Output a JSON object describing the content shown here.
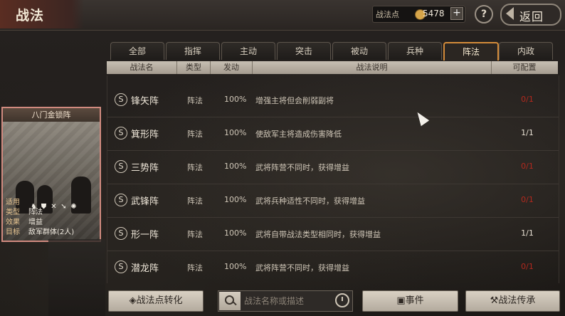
{
  "header": {
    "title": "战法",
    "points_label": "战法点",
    "points_value": "5478",
    "plus": "+",
    "help": "?",
    "back_label": "返回"
  },
  "tabs": [
    {
      "label": "全部"
    },
    {
      "label": "指挥"
    },
    {
      "label": "主动"
    },
    {
      "label": "突击"
    },
    {
      "label": "被动"
    },
    {
      "label": "兵种"
    },
    {
      "label": "阵法",
      "active": true
    },
    {
      "label": "内政"
    }
  ],
  "table": {
    "headers": [
      "战法名",
      "类型",
      "发动",
      "战法说明",
      "可配置"
    ],
    "rows": [
      {
        "grade": "S",
        "name": "锋矢阵",
        "type": "阵法",
        "rate": "100%",
        "desc": "增强主将但会削弱副将",
        "cfg": "0/1",
        "cfg_color": "red"
      },
      {
        "grade": "S",
        "name": "箕形阵",
        "type": "阵法",
        "rate": "100%",
        "desc": "使敌军主将造成伤害降低",
        "cfg": "1/1",
        "cfg_color": "white"
      },
      {
        "grade": "S",
        "name": "三势阵",
        "type": "阵法",
        "rate": "100%",
        "desc": "武将阵营不同时，获得增益",
        "cfg": "0/1",
        "cfg_color": "red"
      },
      {
        "grade": "S",
        "name": "武锋阵",
        "type": "阵法",
        "rate": "100%",
        "desc": "武将兵种适性不同时，获得增益",
        "cfg": "0/1",
        "cfg_color": "red"
      },
      {
        "grade": "S",
        "name": "形一阵",
        "type": "阵法",
        "rate": "100%",
        "desc": "武将自带战法类型相同时，获得增益",
        "cfg": "1/1",
        "cfg_color": "white"
      },
      {
        "grade": "S",
        "name": "潜龙阵",
        "type": "阵法",
        "rate": "100%",
        "desc": "武将阵营不同时，获得增益",
        "cfg": "0/1",
        "cfg_color": "red"
      }
    ]
  },
  "card": {
    "title": "八门金锁阵",
    "fields": [
      {
        "k": "适用",
        "v": ""
      },
      {
        "k": "类型",
        "v": "阵法"
      },
      {
        "k": "效果",
        "v": "增益"
      },
      {
        "k": "目标",
        "v": "敌军群体(2人)"
      }
    ],
    "unit_icons": [
      "cavalry-icon",
      "shield-icon",
      "crossbow-icon",
      "spear-icon",
      "wheel-icon"
    ]
  },
  "bottom": {
    "convert_label": "战法点转化",
    "search_placeholder": "战法名称或描述",
    "events_label": "事件",
    "inherit_label": "战法传承"
  },
  "colors": {
    "accent": "#d38b3a",
    "cfg_red": "#b3291e",
    "card_border": "#d08a7f"
  }
}
